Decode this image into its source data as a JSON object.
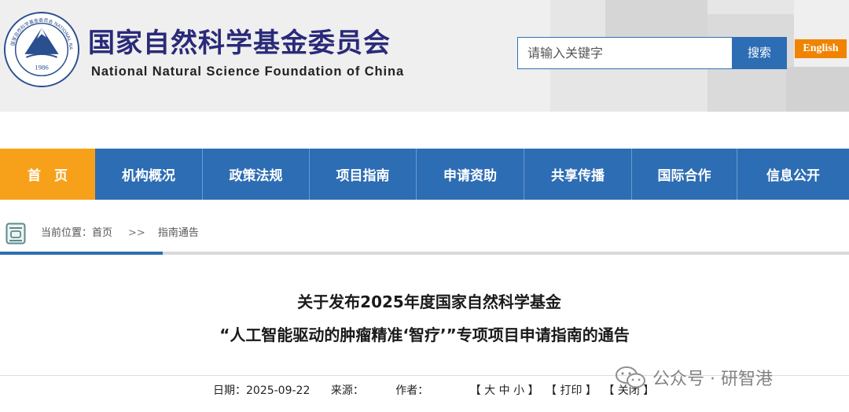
{
  "header": {
    "logo_year": "1986",
    "logo_ring_text": "国家自然科学基金委员会 NATIONAL NATURAL SCIENCE FOUNDATION OF CHINA",
    "cn_title": "国家自然科学基金委员会",
    "en_title": "National Natural Science Foundation of China",
    "search_placeholder": "请输入关键字",
    "search_button": "搜索",
    "english_button": "English"
  },
  "nav": {
    "items": [
      {
        "label": "首　页",
        "active": true
      },
      {
        "label": "机构概况"
      },
      {
        "label": "政策法规"
      },
      {
        "label": "项目指南"
      },
      {
        "label": "申请资助"
      },
      {
        "label": "共享传播"
      },
      {
        "label": "国际合作"
      },
      {
        "label": "信息公开"
      }
    ]
  },
  "breadcrumb": {
    "prefix": "当前位置：",
    "home": "首页",
    "separator": ">>",
    "current": "指南通告"
  },
  "article": {
    "title_line1": "关于发布2025年度国家自然科学基金",
    "title_line2": "“人工智能驱动的肿瘤精准‘智疗’”专项项目申请指南的通告",
    "date_label": "日期：",
    "date": "2025-09-22",
    "source_label": "来源：",
    "author_label": "作者：",
    "font_size_group": "【 大 中 小 】",
    "print_button": "【 打印 】",
    "close_button": "【 关闭 】"
  },
  "watermark": {
    "text": "公众号 · 研智港"
  },
  "colors": {
    "nav_blue": "#2d6db4",
    "nav_active": "#f7a11a",
    "english_orange": "#f08300",
    "title_navy": "#2a2a7a"
  }
}
